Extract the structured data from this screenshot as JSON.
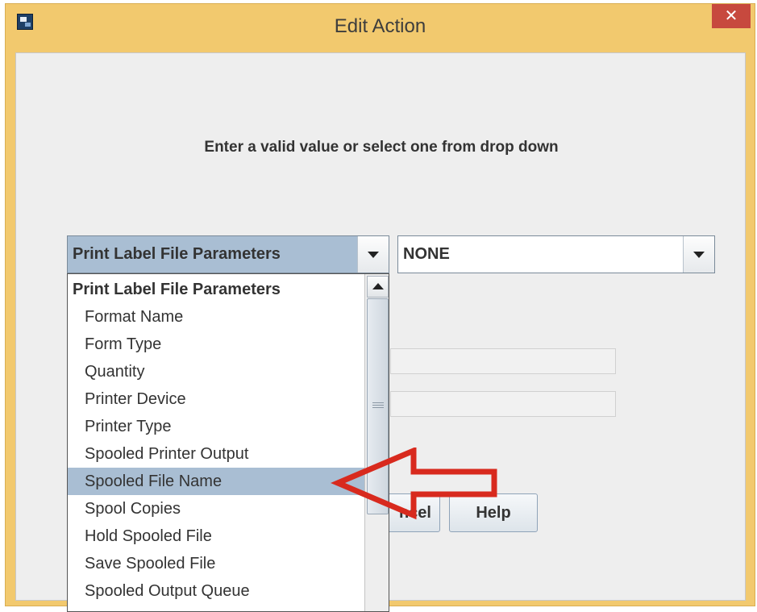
{
  "window": {
    "title": "Edit Action",
    "close_label": "✕"
  },
  "prompt": "Enter a valid value or select one from drop down",
  "combo_left": {
    "selected": "Print Label File Parameters"
  },
  "combo_right": {
    "selected": "NONE"
  },
  "dropdown": {
    "header": "Print Label File Parameters",
    "items": [
      "Format Name",
      "Form Type",
      "Quantity",
      "Printer Device",
      "Printer Type",
      "Spooled Printer Output",
      "Spooled File Name",
      "Spool Copies",
      "Hold Spooled File",
      "Save Spooled File",
      "Spooled Output Queue"
    ],
    "selected_item": "Spooled File Name"
  },
  "buttons": {
    "cancel_partial": "ncel",
    "help": "Help"
  },
  "colors": {
    "window_frame": "#f2c96e",
    "close_button": "#c7493e",
    "selection": "#a9bed3",
    "annotation_arrow": "#d82a1e"
  },
  "icons": [
    "app-icon",
    "close-icon",
    "chevron-down-icon",
    "scroll-up-icon",
    "red-arrow-annotation"
  ]
}
